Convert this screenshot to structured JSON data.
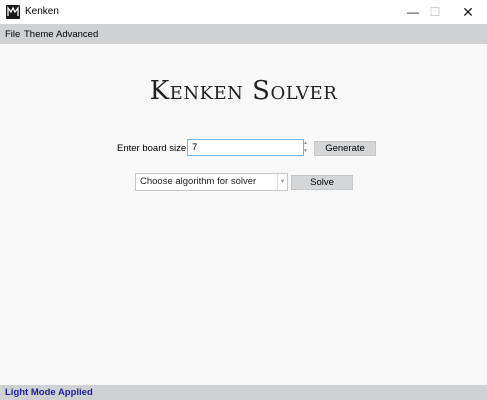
{
  "window": {
    "title": "Kenken",
    "minimize_icon": "minimize-icon",
    "maximize_icon": "maximize-icon",
    "close_icon": "close-icon"
  },
  "menu": {
    "items": [
      "File",
      "Theme",
      "Advanced"
    ]
  },
  "main": {
    "title": "Kenken Solver",
    "board_size_label": "Enter board size",
    "board_size_value": "7",
    "generate_label": "Generate",
    "algorithm_placeholder": "Choose algorithm for solver",
    "solve_label": "Solve"
  },
  "status": {
    "text": "Light Mode Applied",
    "color": "#1f1f9c"
  },
  "colors": {
    "menubar": "#cfd1d3",
    "background": "#f8f8f8",
    "input_focus_border": "#7fb2d8",
    "button": "#d5d6d8"
  }
}
